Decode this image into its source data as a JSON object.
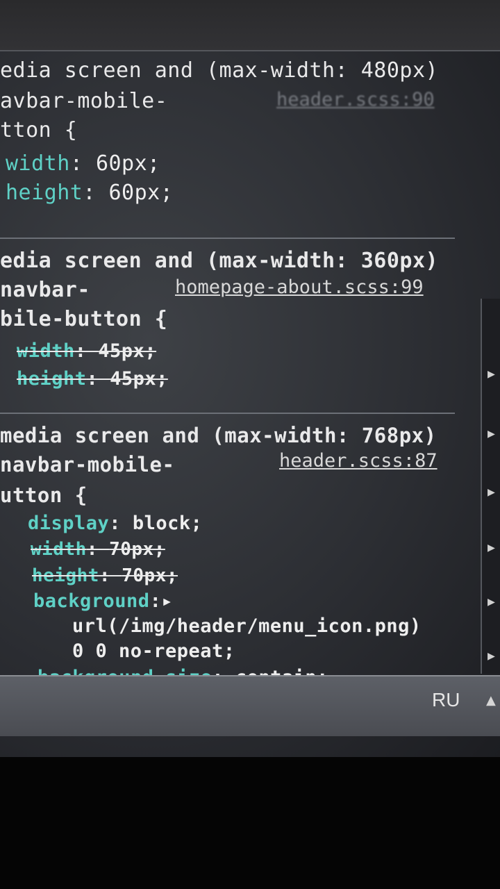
{
  "rules": [
    {
      "media": "edia screen and (max-width: 480px)",
      "selector_lines": [
        "avbar-mobile-",
        "tton {"
      ],
      "source": "header.scss:90",
      "declarations": [
        {
          "prop": "width",
          "value": "60px;",
          "struck": false
        },
        {
          "prop": "height",
          "value": "60px;",
          "struck": false
        }
      ]
    },
    {
      "media": "edia screen and (max-width: 360px)",
      "selector_lines": [
        "navbar-",
        "bile-button {"
      ],
      "source": "homepage-about.scss:99",
      "declarations": [
        {
          "prop": "width",
          "value": "45px;",
          "struck": true
        },
        {
          "prop": "height",
          "value": "45px;",
          "struck": true
        }
      ]
    },
    {
      "media": "media screen and (max-width: 768px)",
      "selector_lines": [
        "navbar-mobile-",
        "utton {"
      ],
      "source": "header.scss:87",
      "declarations": [
        {
          "prop": "display",
          "value": "block;",
          "struck": false
        },
        {
          "prop": "width",
          "value": "70px;",
          "struck": true
        },
        {
          "prop": "height",
          "value": "70px;",
          "struck": true
        },
        {
          "prop": "background",
          "value": "▸",
          "struck": false
        },
        {
          "prop": "",
          "value": "url(/img/header/menu_icon.png)",
          "struck": false
        },
        {
          "prop": "",
          "value": "0 0 no-repeat;",
          "struck": false
        },
        {
          "prop": "background-size",
          "value": "contain;",
          "struck": false
        }
      ]
    }
  ],
  "taskbar": {
    "language": "RU",
    "tray_icon": "tray-chevron-up-icon"
  },
  "gutter": {
    "icon": "expand-arrow-icon",
    "glyph": "▶"
  }
}
